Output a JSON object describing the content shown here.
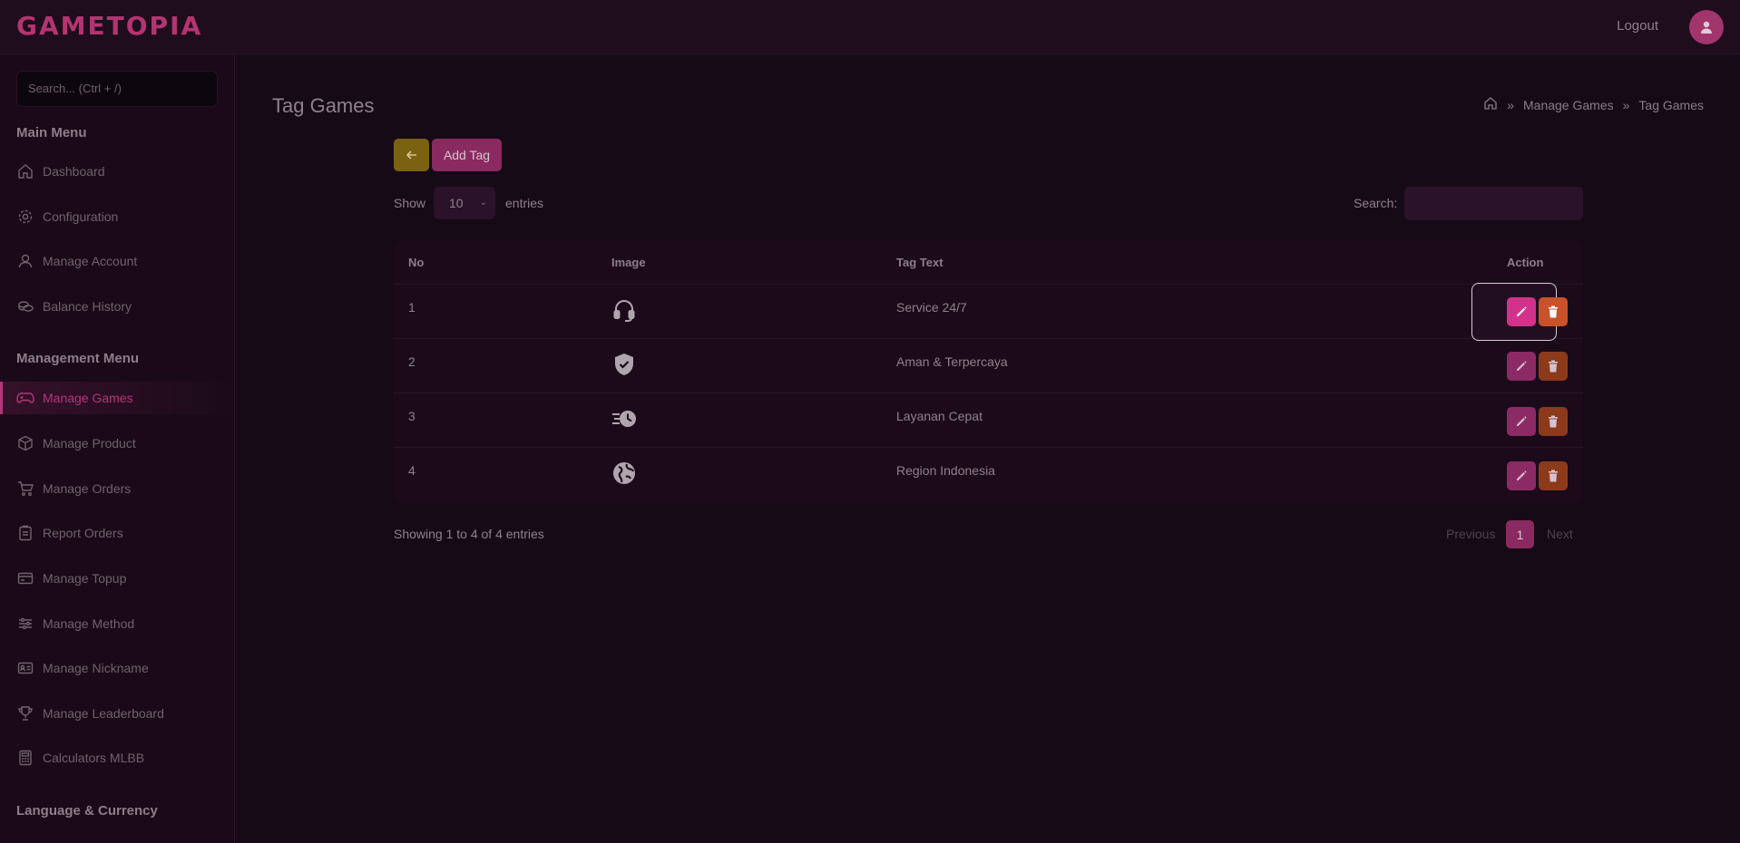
{
  "header": {
    "logo": "GAMETOPIA",
    "logout_label": "Logout"
  },
  "sidebar": {
    "search_placeholder": "Search... (Ctrl + /)",
    "main_menu_title": "Main Menu",
    "main_items": [
      {
        "label": "Dashboard",
        "icon": "home-icon"
      },
      {
        "label": "Configuration",
        "icon": "gear-icon"
      },
      {
        "label": "Manage Account",
        "icon": "user-icon"
      },
      {
        "label": "Balance History",
        "icon": "coins-icon"
      }
    ],
    "management_menu_title": "Management Menu",
    "management_items": [
      {
        "label": "Manage Games",
        "icon": "gamepad-icon",
        "active": true
      },
      {
        "label": "Manage Product",
        "icon": "box-icon"
      },
      {
        "label": "Manage Orders",
        "icon": "cart-icon"
      },
      {
        "label": "Report Orders",
        "icon": "clipboard-icon"
      },
      {
        "label": "Manage Topup",
        "icon": "card-icon"
      },
      {
        "label": "Manage Method",
        "icon": "sliders-icon"
      },
      {
        "label": "Manage Nickname",
        "icon": "id-card-icon"
      },
      {
        "label": "Manage Leaderboard",
        "icon": "trophy-icon"
      },
      {
        "label": "Calculators MLBB",
        "icon": "calculator-icon"
      }
    ],
    "language_title": "Language & Currency"
  },
  "page": {
    "title": "Tag Games",
    "breadcrumb": [
      "Manage Games",
      "Tag Games"
    ],
    "add_button": "Add Tag",
    "show_label": "Show",
    "entries_value": "10",
    "entries_label": "entries",
    "search_label": "Search:",
    "columns": [
      "No",
      "Image",
      "Tag Text",
      "Action"
    ],
    "rows": [
      {
        "no": "1",
        "icon": "headset-icon",
        "tag": "Service 24/7"
      },
      {
        "no": "2",
        "icon": "shield-check-icon",
        "tag": "Aman & Terpercaya"
      },
      {
        "no": "3",
        "icon": "fast-clock-icon",
        "tag": "Layanan Cepat"
      },
      {
        "no": "4",
        "icon": "globe-icon",
        "tag": "Region Indonesia"
      }
    ],
    "info": "Showing 1 to 4 of 4 entries",
    "prev_label": "Previous",
    "page_number": "1",
    "next_label": "Next"
  },
  "colors": {
    "accent": "#b5367a",
    "edit": "#d1338a",
    "delete": "#c9522a",
    "back": "#7a6212"
  }
}
